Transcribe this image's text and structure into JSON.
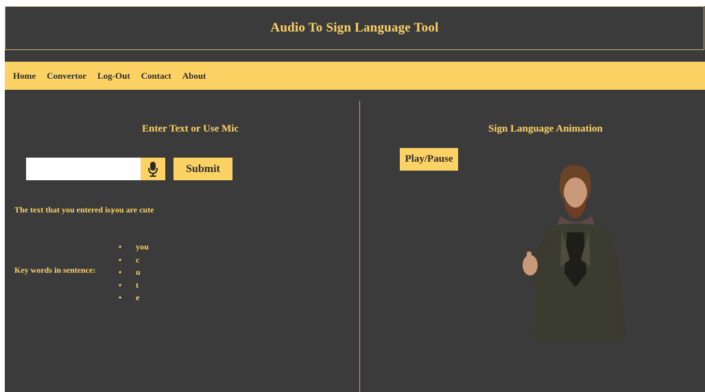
{
  "header": {
    "title": "Audio To Sign Language Tool"
  },
  "nav": {
    "items": [
      "Home",
      "Convertor",
      "Log-Out",
      "Contact",
      "About"
    ]
  },
  "left_panel": {
    "heading": "Enter Text or Use Mic",
    "input": {
      "value": "",
      "placeholder": ""
    },
    "mic_icon": "microphone-icon",
    "submit_label": "Submit",
    "entered_label": "The text that you entered is:",
    "entered_value": "you are cute",
    "keywords_label": "Key words in sentence:",
    "keywords": [
      "you",
      "c",
      "u",
      "t",
      "e"
    ]
  },
  "right_panel": {
    "heading": "Sign Language Animation",
    "play_label": "Play/Pause"
  },
  "colors": {
    "accent": "#fcd265",
    "background": "#3b3b3b",
    "text_dark": "#2e2e2e"
  }
}
